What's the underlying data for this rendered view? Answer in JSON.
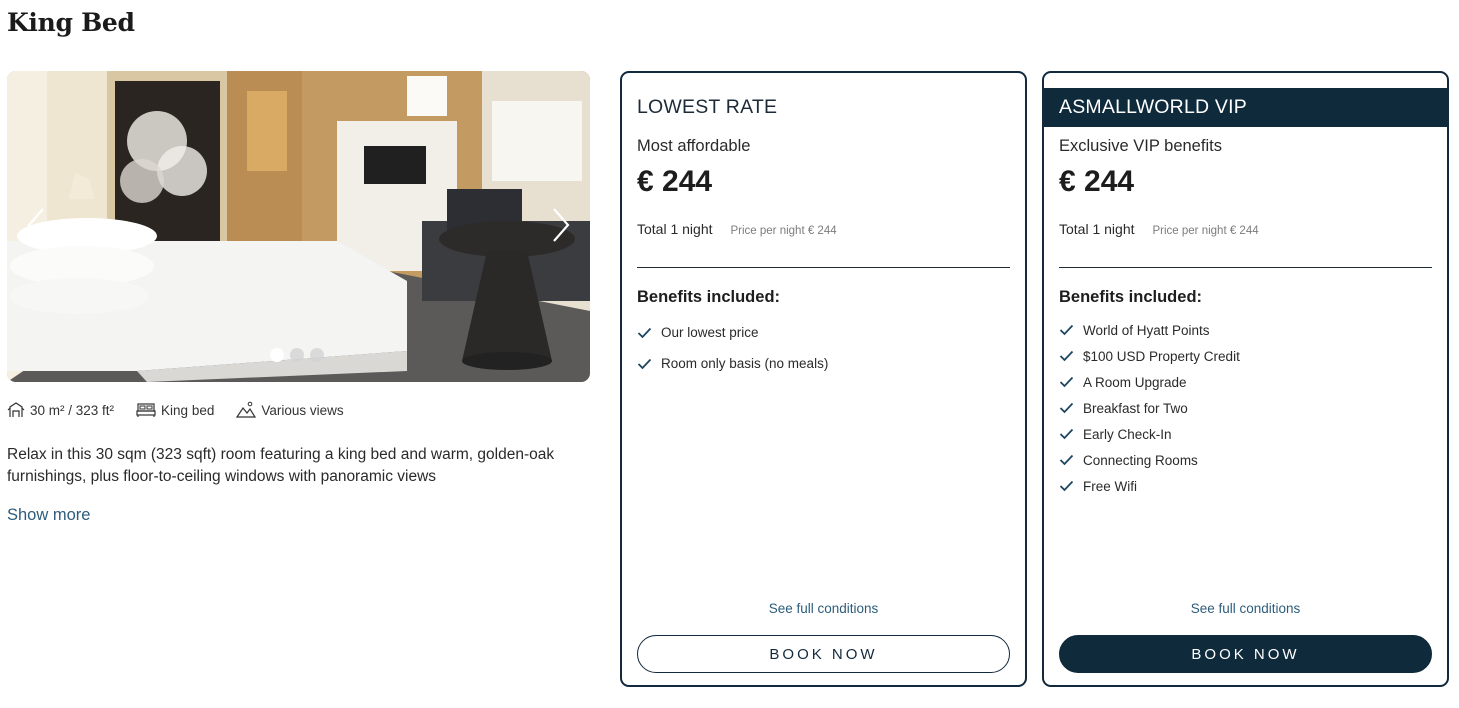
{
  "room": {
    "title": "King Bed",
    "features": [
      {
        "icon": "room-size-icon",
        "label": "30 m² / 323 ft²"
      },
      {
        "icon": "bed-icon",
        "label": "King bed"
      },
      {
        "icon": "mountain-view-icon",
        "label": "Various views"
      }
    ],
    "description": "Relax in this 30 sqm (323 sqft) room featuring a king bed and warm, golden-oak furnishings, plus floor-to-ceiling windows with panoramic views",
    "show_more": "Show more",
    "gallery": {
      "image_count": 3,
      "active_index": 0
    }
  },
  "rates": [
    {
      "header": "LOWEST RATE",
      "subtitle": "Most affordable",
      "price": "€ 244",
      "total_label": "Total 1 night",
      "per_night": "Price per night € 244",
      "benefits_title": "Benefits included:",
      "benefits": [
        "Our lowest price",
        "Room only basis (no meals)"
      ],
      "conditions": "See full conditions",
      "book": "BOOK NOW"
    },
    {
      "header": "ASMALLWORLD VIP",
      "subtitle": "Exclusive VIP benefits",
      "price": "€ 244",
      "total_label": "Total 1 night",
      "per_night": "Price per night € 244",
      "benefits_title": "Benefits included:",
      "benefits": [
        "World of Hyatt Points",
        "$100 USD Property Credit",
        "A Room Upgrade",
        "Breakfast for Two",
        "Early Check-In",
        "Connecting Rooms",
        "Free Wifi"
      ],
      "conditions": "See full conditions",
      "book": "BOOK NOW"
    }
  ],
  "colors": {
    "navy": "#0e2a3b",
    "link": "#2d5d7b"
  }
}
